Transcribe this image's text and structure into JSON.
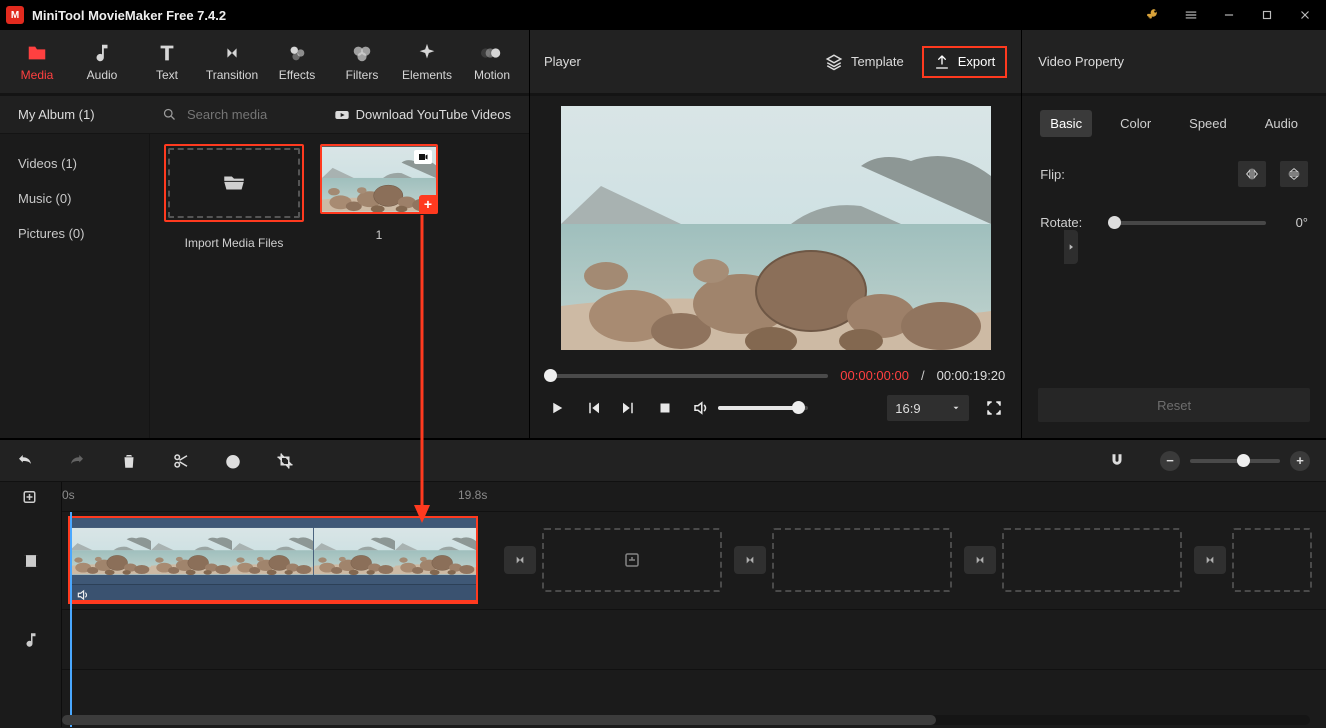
{
  "app": {
    "title": "MiniTool MovieMaker Free 7.4.2"
  },
  "tabs": {
    "media": {
      "label": "Media"
    },
    "audio": {
      "label": "Audio"
    },
    "text": {
      "label": "Text"
    },
    "transition": {
      "label": "Transition"
    },
    "effects": {
      "label": "Effects"
    },
    "filters": {
      "label": "Filters"
    },
    "elements": {
      "label": "Elements"
    },
    "motion": {
      "label": "Motion"
    }
  },
  "library": {
    "album_label": "My Album (1)",
    "search_placeholder": "Search media",
    "youtube_label": "Download YouTube Videos",
    "side": {
      "videos": "Videos (1)",
      "music": "Music (0)",
      "pictures": "Pictures (0)"
    },
    "import_label": "Import Media Files",
    "clip1_label": "1"
  },
  "player": {
    "title": "Player",
    "template_label": "Template",
    "export_label": "Export",
    "time_current": "00:00:00:00",
    "time_separator": "/",
    "time_total": "00:00:19:20",
    "aspect": "16:9"
  },
  "property": {
    "title": "Video Property",
    "tabs": {
      "basic": "Basic",
      "color": "Color",
      "speed": "Speed",
      "audio": "Audio"
    },
    "flip_label": "Flip:",
    "rotate_label": "Rotate:",
    "rotate_value": "0°",
    "reset_label": "Reset"
  },
  "timeline": {
    "ruler": {
      "t0": "0s",
      "t1": "19.8s"
    }
  }
}
